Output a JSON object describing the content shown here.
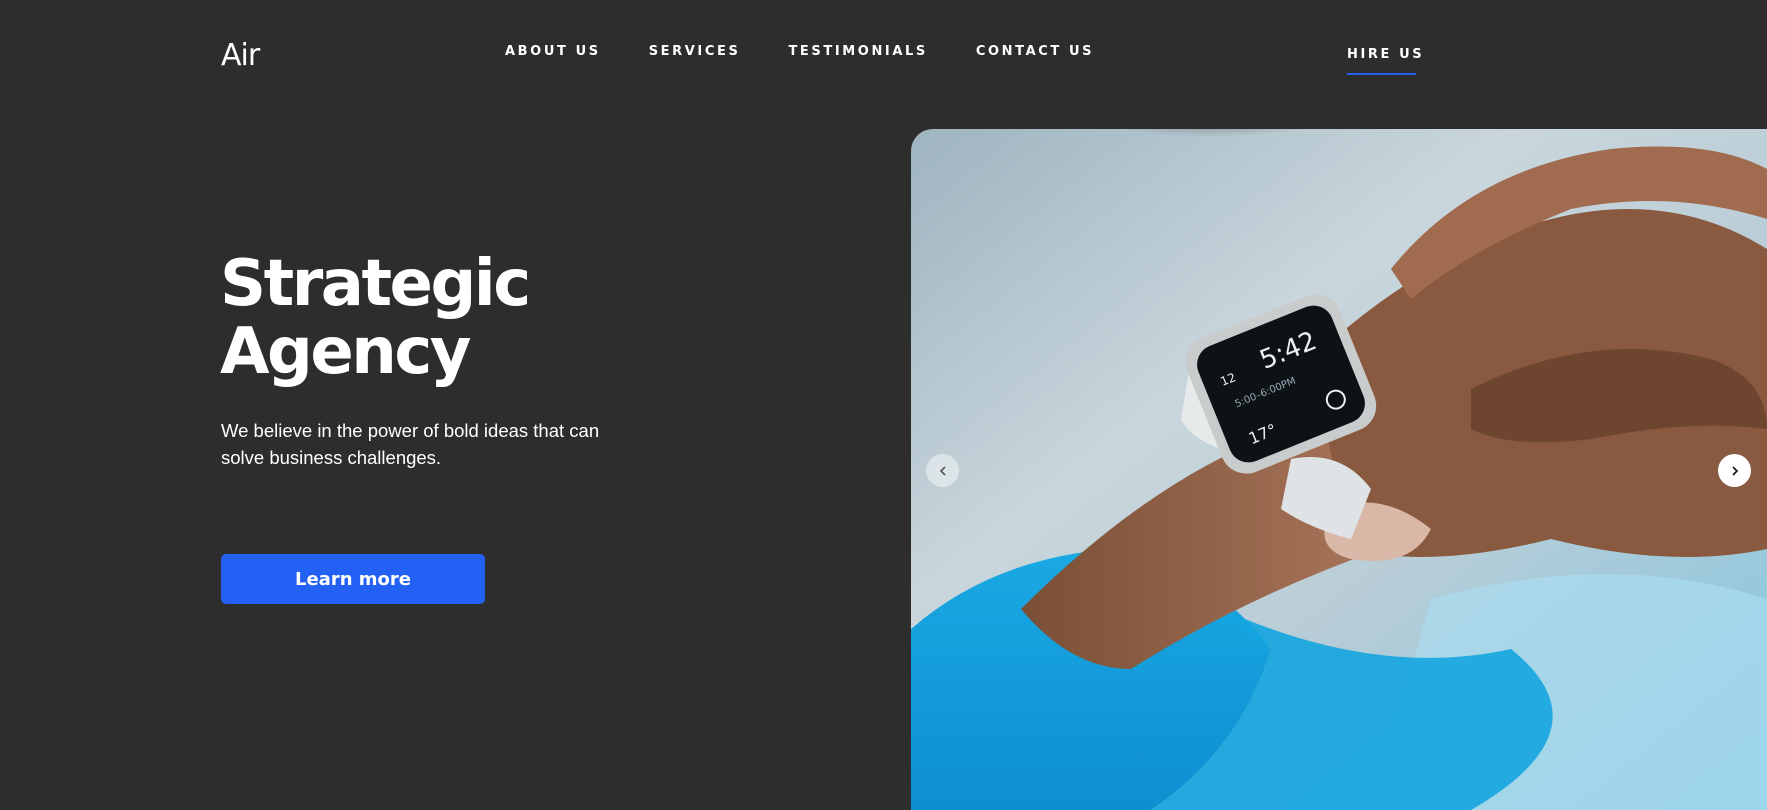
{
  "header": {
    "logo": "Air",
    "nav": [
      {
        "label": "ABOUT US"
      },
      {
        "label": "SERVICES"
      },
      {
        "label": "TESTIMONIALS"
      },
      {
        "label": "CONTACT US"
      }
    ],
    "hire_label": "HIRE US"
  },
  "hero": {
    "title_line1": "Strategic",
    "title_line2": "Agency",
    "subtitle": "We believe in the power of bold ideas that can solve business challenges.",
    "cta_label": "Learn more"
  },
  "slider": {
    "prev_icon": "chevron-left-icon",
    "next_icon": "chevron-right-icon"
  },
  "colors": {
    "background": "#2d2d2d",
    "accent": "#2361f5",
    "text": "#ffffff"
  }
}
